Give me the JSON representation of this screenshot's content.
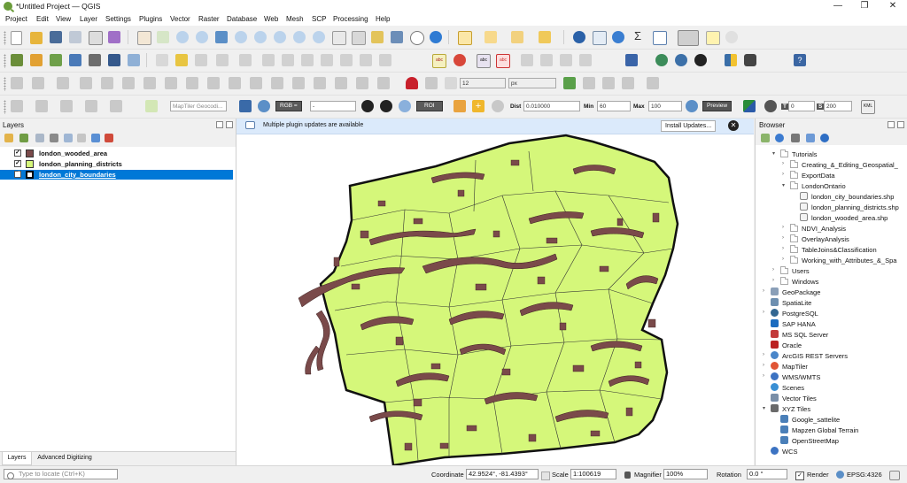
{
  "window": {
    "title": "*Untitled Project — QGIS",
    "minimize": "—",
    "maximize": "❐",
    "close": "✕"
  },
  "menu": [
    "Project",
    "Edit",
    "View",
    "Layer",
    "Settings",
    "Plugins",
    "Vector",
    "Raster",
    "Database",
    "Web",
    "Mesh",
    "SCP",
    "Processing",
    "Help"
  ],
  "toolbar": {
    "snapping_tolerance": "12",
    "snapping_unit": "px",
    "geocoder_placeholder": "MapTiler Geocodi...",
    "scp": {
      "rgb_label": "RGB =",
      "rgb_value": "-",
      "roi_label": "ROI",
      "dist_label": "Dist",
      "dist_value": "0.010000",
      "min_label": "Min",
      "min_value": "60",
      "max_label": "Max",
      "max_value": "100",
      "preview_label": "Preview",
      "t_label": "T",
      "t_value": "0",
      "s_label": "S",
      "s_value": "200"
    }
  },
  "layers_panel": {
    "title": "Layers",
    "layers": [
      {
        "name": "london_wooded_area",
        "checked": "✓",
        "color": "#7a4a4a"
      },
      {
        "name": "london_planning_districts",
        "checked": "✓",
        "color": "#d5f77a"
      },
      {
        "name": "london_city_boundaries",
        "checked": "✓",
        "color": "#1a5fb4"
      }
    ],
    "tabs": [
      "Layers",
      "Advanced Digitizing"
    ]
  },
  "notification": {
    "message": "Multiple plugin updates are available",
    "button": "Install Updates...",
    "close": "✕"
  },
  "browser_panel": {
    "title": "Browser",
    "items": [
      {
        "label": "Tutorials",
        "level": 1,
        "kind": "folder",
        "expanded": true
      },
      {
        "label": "Creating_&_Editing_Geospatial_",
        "level": 2,
        "kind": "folder"
      },
      {
        "label": "ExportData",
        "level": 2,
        "kind": "folder"
      },
      {
        "label": "LondonOntario",
        "level": 2,
        "kind": "folder",
        "expanded": true
      },
      {
        "label": "london_city_boundaries.shp",
        "level": 3,
        "kind": "shp"
      },
      {
        "label": "london_planning_districts.shp",
        "level": 3,
        "kind": "shp"
      },
      {
        "label": "london_wooded_area.shp",
        "level": 3,
        "kind": "shp"
      },
      {
        "label": "NDVI_Analysis",
        "level": 2,
        "kind": "folder"
      },
      {
        "label": "OverlayAnalysis",
        "level": 2,
        "kind": "folder"
      },
      {
        "label": "TableJoins&Classification",
        "level": 2,
        "kind": "folder"
      },
      {
        "label": "Working_with_Attributes_&_Spa",
        "level": 2,
        "kind": "folder"
      },
      {
        "label": "Users",
        "level": 1,
        "kind": "folder"
      },
      {
        "label": "Windows",
        "level": 1,
        "kind": "folder"
      },
      {
        "label": "GeoPackage",
        "level": 0,
        "kind": "geopackage"
      },
      {
        "label": "SpatiaLite",
        "level": 0,
        "kind": "spatialite"
      },
      {
        "label": "PostgreSQL",
        "level": 0,
        "kind": "postgres"
      },
      {
        "label": "SAP HANA",
        "level": 0,
        "kind": "hana"
      },
      {
        "label": "MS SQL Server",
        "level": 0,
        "kind": "mssql"
      },
      {
        "label": "Oracle",
        "level": 0,
        "kind": "oracle"
      },
      {
        "label": "ArcGIS REST Servers",
        "level": 0,
        "kind": "arcgis"
      },
      {
        "label": "MapTiler",
        "level": 0,
        "kind": "maptiler"
      },
      {
        "label": "WMS/WMTS",
        "level": 0,
        "kind": "wms"
      },
      {
        "label": "Scenes",
        "level": 0,
        "kind": "scenes"
      },
      {
        "label": "Vector Tiles",
        "level": 0,
        "kind": "vectortiles"
      },
      {
        "label": "XYZ Tiles",
        "level": 0,
        "kind": "xyz",
        "expanded": true
      },
      {
        "label": "Google_sattelite",
        "level": 1,
        "kind": "tile"
      },
      {
        "label": "Mapzen Global Terrain",
        "level": 1,
        "kind": "tile"
      },
      {
        "label": "OpenStreetMap",
        "level": 1,
        "kind": "tile"
      },
      {
        "label": "WCS",
        "level": 0,
        "kind": "wcs"
      }
    ]
  },
  "statusbar": {
    "locator_placeholder": "Type to locate (Ctrl+K)",
    "coordinate_label": "Coordinate",
    "coordinate_value": "42.9524°, -81.4393°",
    "scale_label": "Scale",
    "scale_value": "1:100619",
    "magnifier_label": "Magnifier",
    "magnifier_value": "100%",
    "rotation_label": "Rotation",
    "rotation_value": "0.0 °",
    "render_label": "Render",
    "render_checked": "✓",
    "crs": "EPSG:4326"
  },
  "colors": {
    "district_fill": "#d5f77a",
    "wooded_fill": "#7a4a4a",
    "selection": "#0078d7",
    "notification_bg": "#dbeafb"
  }
}
